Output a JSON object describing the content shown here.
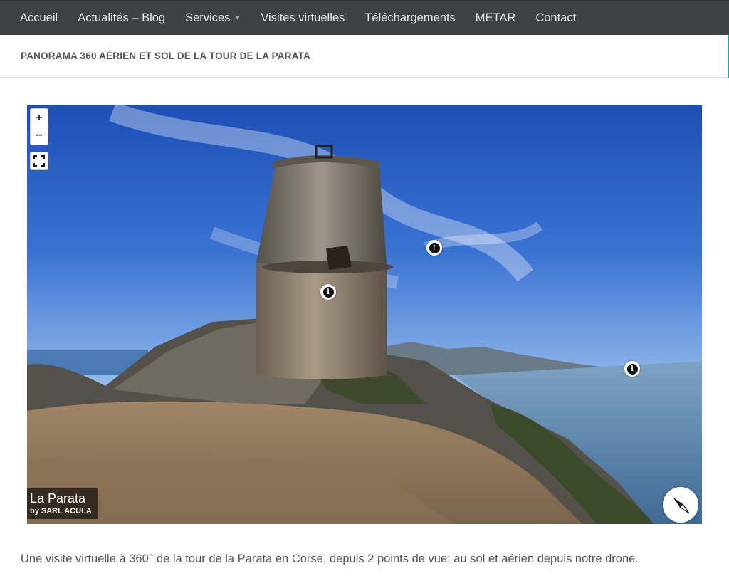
{
  "nav": {
    "items": [
      {
        "label": "Accueil"
      },
      {
        "label": "Actualités – Blog"
      },
      {
        "label": "Services",
        "has_dropdown": true
      },
      {
        "label": "Visites virtuelles"
      },
      {
        "label": "Téléchargements"
      },
      {
        "label": "METAR"
      },
      {
        "label": "Contact"
      }
    ],
    "dropdown_icon": "chevron-down-icon",
    "background_color": "#3d4246"
  },
  "page": {
    "title": "PANORAMA 360 AÉRIEN ET SOL DE LA TOUR DE LA PARATA"
  },
  "panorama": {
    "controls": {
      "zoom_in_label": "+",
      "zoom_out_label": "−",
      "fullscreen_icon": "fullscreen-icon"
    },
    "hotspots": [
      {
        "type": "info",
        "icon": "info-icon",
        "glyph": "i"
      },
      {
        "type": "navigation",
        "icon": "arrow-up-icon",
        "glyph": "↑"
      },
      {
        "type": "info",
        "icon": "info-icon",
        "glyph": "i"
      }
    ],
    "caption": {
      "title": "La Parata",
      "author": "by SARL ACULA"
    },
    "compass_icon": "compass-icon"
  },
  "description": "Une visite virtuelle à 360° de la tour de la Parata en Corse, depuis 2 points de vue: au sol et aérien depuis notre drone."
}
